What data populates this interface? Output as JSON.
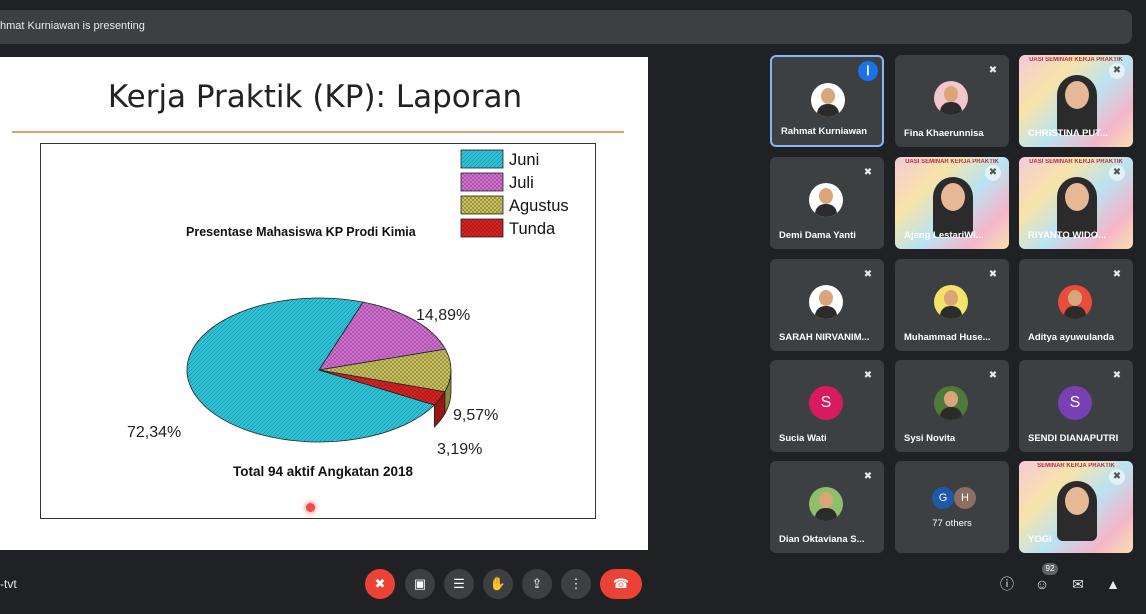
{
  "presenting_text": "hmat Kurniawan is presenting",
  "slide": {
    "title": "Kerja Praktik (KP): Laporan",
    "chart_title": "Presentase Mahasiswa KP Prodi Kimia",
    "footer": "Total 94 aktif Angkatan 2018"
  },
  "chart_data": {
    "type": "pie",
    "title": "Presentase Mahasiswa KP Prodi Kimia",
    "categories": [
      "Juni",
      "Juli",
      "Agustus",
      "Tunda"
    ],
    "values": [
      72.34,
      14.89,
      9.57,
      3.19
    ],
    "labels": [
      "72,34%",
      "14,89%",
      "9,57%",
      "3,19%"
    ],
    "colors": [
      "#2cc3d9",
      "#d86fd8",
      "#c9c25a",
      "#e02020"
    ],
    "legend_position": "top-right",
    "footer": "Total 94 aktif Angkatan 2018"
  },
  "participants": [
    {
      "name": "Rahmat Kurniawan",
      "kind": "avatar-photo",
      "color": "#ffffff",
      "speaking": true
    },
    {
      "name": "Fina Khaerunnisa",
      "kind": "avatar-photo",
      "color": "#f2c6cc",
      "muted": true
    },
    {
      "name": "CHRISTINA PUT...",
      "kind": "video",
      "banner": "UASI SEMINAR KERJA PRAKTIK"
    },
    {
      "name": "Demi Dama Yanti",
      "kind": "avatar-photo",
      "color": "#ffffff",
      "muted": true
    },
    {
      "name": "Ajeng LestariWi...",
      "kind": "video",
      "banner": "UASI SEMINAR KERJA PRAKTIK"
    },
    {
      "name": "RIYANTO WIDO...",
      "kind": "video",
      "banner": "UASI SEMINAR KERJA PRAKTIK"
    },
    {
      "name": "SARAH NIRVANIM...",
      "kind": "avatar-photo",
      "color": "#ffffff",
      "muted": true
    },
    {
      "name": "Muhammad Huse...",
      "kind": "avatar-photo",
      "color": "#f4e26a",
      "muted": true
    },
    {
      "name": "Aditya ayuwulanda",
      "kind": "avatar-photo",
      "color": "#e94b3c",
      "muted": true
    },
    {
      "name": "Sucia Wati",
      "kind": "avatar-letter",
      "letter": "S",
      "color": "#d81b60",
      "muted": true
    },
    {
      "name": "Sysi Novita",
      "kind": "avatar-photo",
      "color": "#4f7a3a",
      "muted": true
    },
    {
      "name": "SENDI DIANAPUTRI",
      "kind": "avatar-letter",
      "letter": "S",
      "color": "#7b3fb5",
      "muted": true
    },
    {
      "name": "Dian Oktaviana S...",
      "kind": "avatar-photo",
      "color": "#8fbf6a",
      "muted": true
    },
    {
      "name": "77 others",
      "kind": "others",
      "letters": [
        "G",
        "H"
      ]
    },
    {
      "name": "YOGI",
      "kind": "video",
      "banner": "SEMINAR KERJA PRAKTIK"
    }
  ],
  "meeting_code": "-tvt",
  "participants_count": "92",
  "controls": {
    "mic": "mic-off-icon",
    "camera": "camera-icon",
    "captions": "captions-icon",
    "hand": "raise-hand-icon",
    "present": "present-icon",
    "more": "more-options-icon",
    "end": "end-call-icon"
  }
}
